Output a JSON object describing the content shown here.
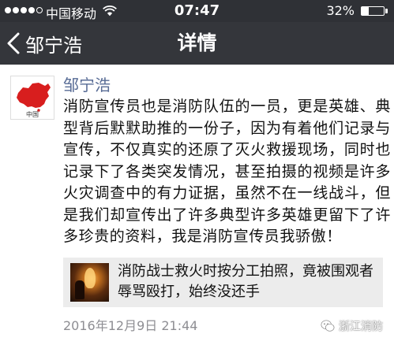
{
  "status_bar": {
    "carrier": "中国移动",
    "time": "07:47",
    "battery_percent": "32%",
    "battery_level": 0.32,
    "signal_strength": 4,
    "signal_max": 5,
    "icons": [
      "signal-dots-icon",
      "wifi-icon",
      "battery-icon"
    ]
  },
  "nav": {
    "back_label": "邹宁浩",
    "title": "详情",
    "back_icon": "chevron-left-icon"
  },
  "post": {
    "author": "邹宁浩",
    "avatar_icon": "china-map-avatar-icon",
    "avatar_text": "中国",
    "text": "消防宣传员也是消防队伍的一员，更是英雄、典型背后默默助推的一份子，因为有着他们记录与宣传，不仅真实的还原了灭火救援现场，同时也记录下了各类突发情况，甚至拍摄的视频是许多火灾调查中的有力证据，虽然不在一线战斗，但是我们却宣传出了许多典型许多英雄更留下了许多珍贵的资料，我是消防宣传员我骄傲！",
    "shared_link": {
      "title": "消防战士救火时按分工拍照，竟被围观者辱骂殴打，始终没还手",
      "thumbnail_icon": "fire-scene-thumbnail"
    },
    "timestamp": "2016年12月9日  21:44"
  },
  "watermark": {
    "label": "浙江消防",
    "icon": "wechat-logo-icon"
  },
  "colors": {
    "status_bar_bg": "#2f3136",
    "nav_bar_bg": "#34363b",
    "author_link": "#576b95",
    "timestamp": "#8e8e93",
    "link_card_bg": "#ececec",
    "map_red": "#d81e1e"
  }
}
